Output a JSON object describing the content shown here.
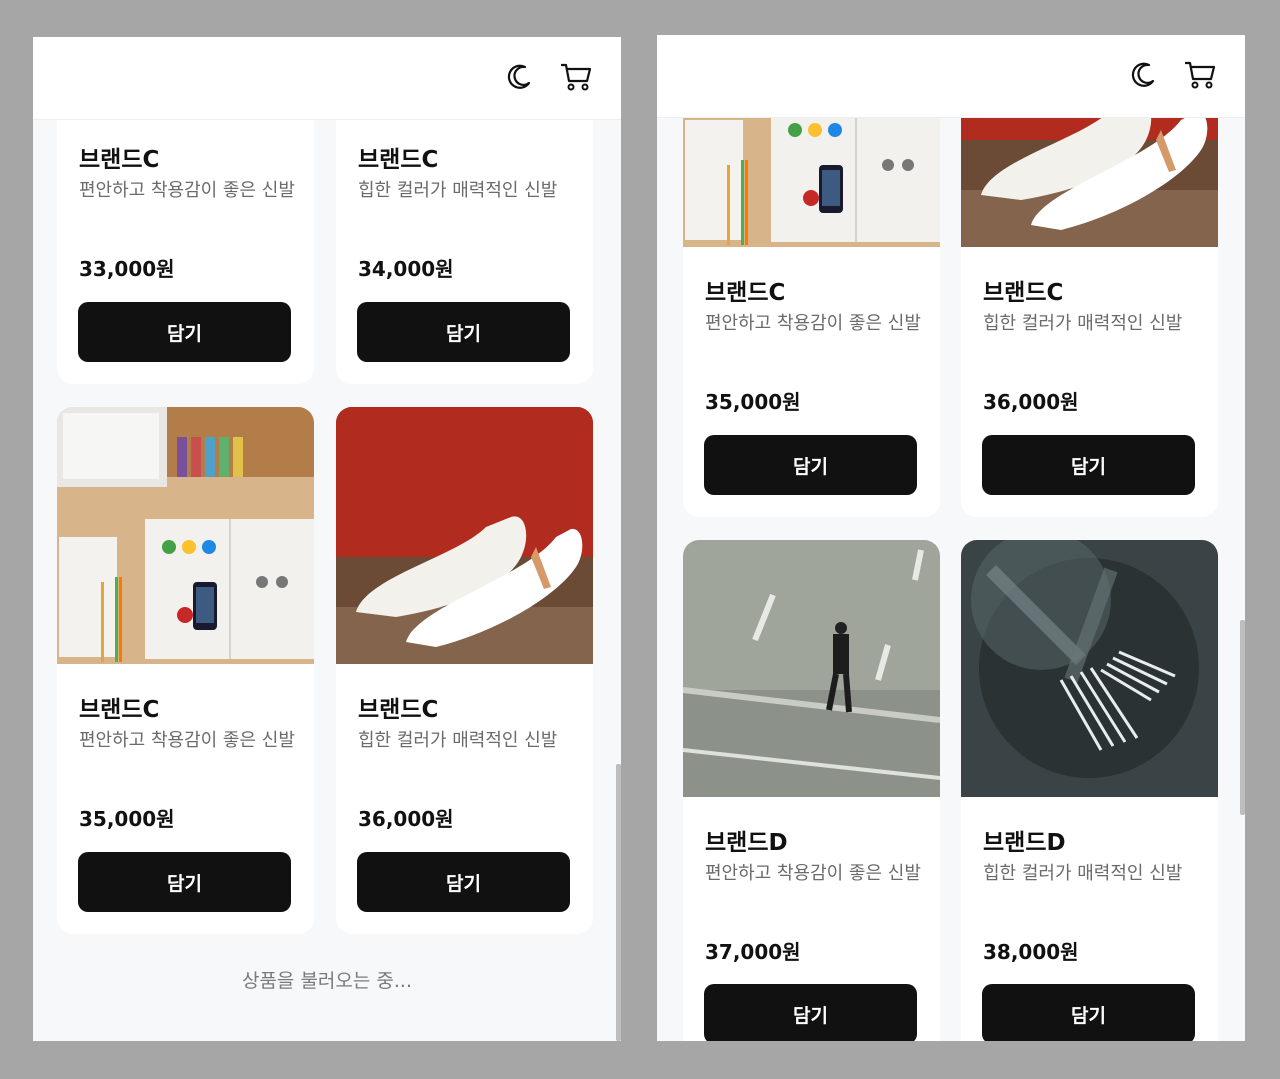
{
  "icons": {
    "theme": "moon-icon",
    "cart": "cart-icon"
  },
  "left": {
    "cards": [
      {
        "brand": "브랜드C",
        "desc": "편안하고 착용감이 좋은 신발",
        "price": "33,000원",
        "button": "담기"
      },
      {
        "brand": "브랜드C",
        "desc": "힙한 컬러가 매력적인 신발",
        "price": "34,000원",
        "button": "담기"
      },
      {
        "brand": "브랜드C",
        "desc": "편안하고 착용감이 좋은 신발",
        "price": "35,000원",
        "button": "담기"
      },
      {
        "brand": "브랜드C",
        "desc": "힙한 컬러가 매력적인 신발",
        "price": "36,000원",
        "button": "담기"
      }
    ],
    "loading": "상품을 불러오는 중..."
  },
  "right": {
    "cards": [
      {
        "brand": "브랜드C",
        "desc": "편안하고 착용감이 좋은 신발",
        "price": "35,000원",
        "button": "담기"
      },
      {
        "brand": "브랜드C",
        "desc": "힙한 컬러가 매력적인 신발",
        "price": "36,000원",
        "button": "담기"
      },
      {
        "brand": "브랜드D",
        "desc": "편안하고 착용감이 좋은 신발",
        "price": "37,000원",
        "button": "담기"
      },
      {
        "brand": "브랜드D",
        "desc": "힙한 컬러가 매력적인 신발",
        "price": "38,000원",
        "button": "담기"
      }
    ]
  }
}
